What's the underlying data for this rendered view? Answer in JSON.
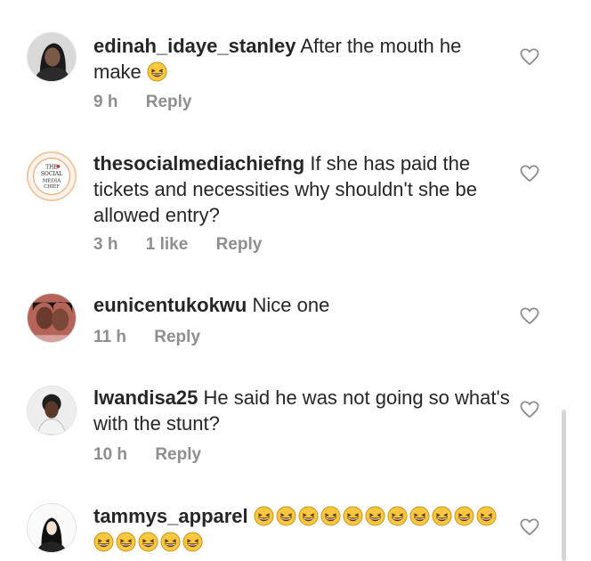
{
  "comments": [
    {
      "username": "edinah_idaye_stanley",
      "text": "After the mouth he make",
      "emoji_icons": [
        "laughing-face-icon"
      ],
      "time": "9 h",
      "likes": "",
      "reply_label": "Reply"
    },
    {
      "username": "thesocialmediachiefng",
      "text": "If she has paid the tickets and necessities why shouldn't she be allowed entry?",
      "avatar_text": [
        "THE",
        "SOCIAL",
        "MEDIA",
        "CHIEF"
      ],
      "time": "3 h",
      "likes": "1 like",
      "reply_label": "Reply"
    },
    {
      "username": "eunicentukokwu",
      "text": "Nice one",
      "time": "11 h",
      "likes": "",
      "reply_label": "Reply"
    },
    {
      "username": "lwandisa25",
      "text": "He said he was not going so what's with the stunt?",
      "time": "10 h",
      "likes": "",
      "reply_label": "Reply"
    },
    {
      "username": "tammys_apparel",
      "text": "",
      "emoji_icons": [
        "laughing-face-icon",
        "laughing-face-icon",
        "laughing-face-icon",
        "laughing-face-icon",
        "laughing-face-icon",
        "laughing-face-icon",
        "laughing-face-icon",
        "laughing-face-icon",
        "laughing-face-icon",
        "laughing-face-icon",
        "laughing-face-icon",
        "laughing-face-icon",
        "laughing-face-icon",
        "laughing-face-icon",
        "laughing-face-icon",
        "laughing-face-icon"
      ],
      "time": "",
      "likes": "",
      "reply_label": ""
    }
  ],
  "icons": {
    "like": "heart-outline-icon",
    "emoji": "laughing-face-icon"
  },
  "colors": {
    "text": "#262626",
    "meta": "#8e8e8e",
    "heart": "#8e8e8e",
    "emoji_fill": "#f7c740"
  }
}
